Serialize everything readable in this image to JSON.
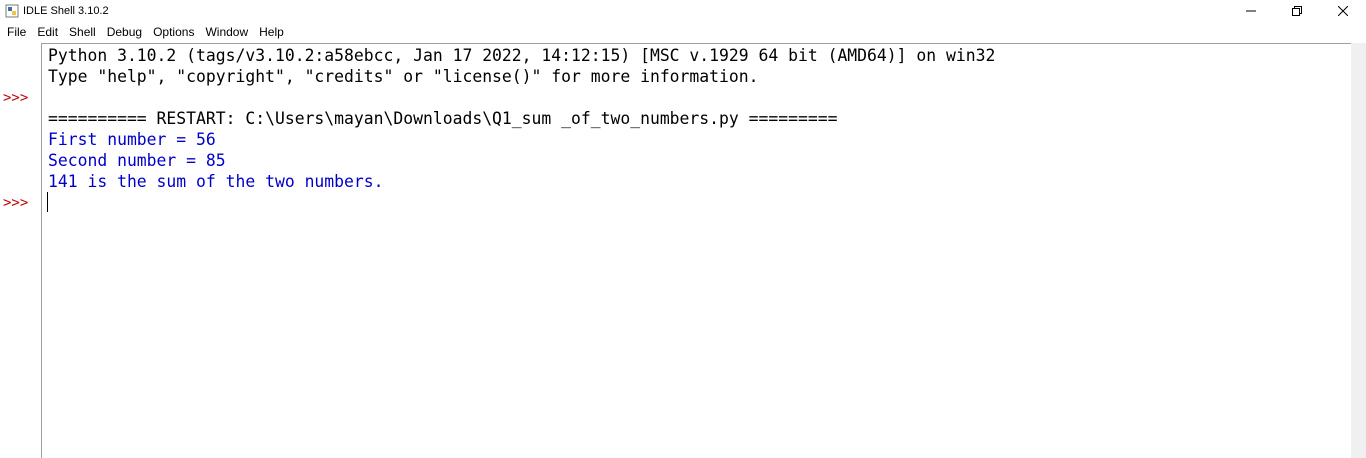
{
  "window": {
    "title": "IDLE Shell 3.10.2"
  },
  "menu": {
    "items": [
      {
        "label": "File"
      },
      {
        "label": "Edit"
      },
      {
        "label": "Shell"
      },
      {
        "label": "Debug"
      },
      {
        "label": "Options"
      },
      {
        "label": "Window"
      },
      {
        "label": "Help"
      }
    ]
  },
  "shell": {
    "prompt": ">>>",
    "lines": [
      {
        "text": "Python 3.10.2 (tags/v3.10.2:a58ebcc, Jan 17 2022, 14:12:15) [MSC v.1929 64 bit (AMD64)] on win32",
        "kind": "banner"
      },
      {
        "text": "Type \"help\", \"copyright\", \"credits\" or \"license()\" for more information.",
        "kind": "banner"
      },
      {
        "text": "",
        "kind": "prompt-line"
      },
      {
        "text": "========== RESTART: C:\\Users\\mayan\\Downloads\\Q1_sum _of_two_numbers.py =========",
        "kind": "restart"
      },
      {
        "text": "First number = 56",
        "kind": "stdout"
      },
      {
        "text": "Second number = 85",
        "kind": "stdout"
      },
      {
        "text": "141 is the sum of the two numbers.",
        "kind": "stdout"
      }
    ]
  },
  "icons": {
    "app": "python-idle-icon",
    "minimize": "minimize-icon",
    "maximize": "restore-icon",
    "close": "close-icon"
  },
  "colors": {
    "stdout": "#0000cc",
    "prompt": "#c00000",
    "text": "#000000"
  }
}
